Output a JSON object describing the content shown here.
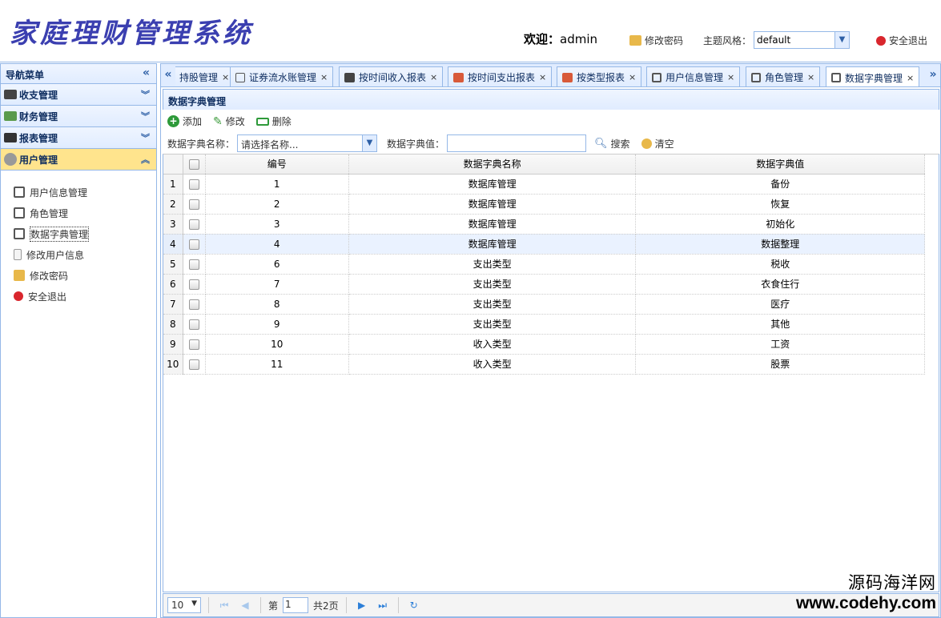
{
  "header": {
    "app_title": "家庭理财管理系统",
    "welcome_label": "欢迎：",
    "username": "admin",
    "change_password": "修改密码",
    "theme_label": "主题风格：",
    "theme_value": "default",
    "logout": "安全退出"
  },
  "sidebar": {
    "title": "导航菜单",
    "sections": [
      {
        "label": "收支管理"
      },
      {
        "label": "财务管理"
      },
      {
        "label": "报表管理"
      },
      {
        "label": "用户管理"
      }
    ],
    "items": [
      {
        "label": "用户信息管理"
      },
      {
        "label": "角色管理"
      },
      {
        "label": "数据字典管理"
      },
      {
        "label": "修改用户信息"
      },
      {
        "label": "修改密码"
      },
      {
        "label": "安全退出"
      }
    ]
  },
  "tabs": [
    {
      "label": "持股管理"
    },
    {
      "label": "证券流水账管理"
    },
    {
      "label": "按时间收入报表"
    },
    {
      "label": "按时间支出报表"
    },
    {
      "label": "按类型报表"
    },
    {
      "label": "用户信息管理"
    },
    {
      "label": "角色管理"
    },
    {
      "label": "数据字典管理"
    }
  ],
  "panel": {
    "title": "数据字典管理",
    "toolbar": {
      "add": "添加",
      "edit": "修改",
      "delete": "删除"
    },
    "search": {
      "name_label": "数据字典名称：",
      "name_value": "请选择名称...",
      "value_label": "数据字典值：",
      "search_btn": "搜索",
      "clear_btn": "清空"
    },
    "columns": [
      "编号",
      "数据字典名称",
      "数据字典值"
    ],
    "rows": [
      {
        "n": "1",
        "id": "1",
        "name": "数据库管理",
        "value": "备份"
      },
      {
        "n": "2",
        "id": "2",
        "name": "数据库管理",
        "value": "恢复"
      },
      {
        "n": "3",
        "id": "3",
        "name": "数据库管理",
        "value": "初始化"
      },
      {
        "n": "4",
        "id": "4",
        "name": "数据库管理",
        "value": "数据整理"
      },
      {
        "n": "5",
        "id": "6",
        "name": "支出类型",
        "value": "税收"
      },
      {
        "n": "6",
        "id": "7",
        "name": "支出类型",
        "value": "衣食住行"
      },
      {
        "n": "7",
        "id": "8",
        "name": "支出类型",
        "value": "医疗"
      },
      {
        "n": "8",
        "id": "9",
        "name": "支出类型",
        "value": "其他"
      },
      {
        "n": "9",
        "id": "10",
        "name": "收入类型",
        "value": "工资"
      },
      {
        "n": "10",
        "id": "11",
        "name": "收入类型",
        "value": "股票"
      }
    ]
  },
  "pager": {
    "page_size": "10",
    "page_prefix": "第",
    "page_value": "1",
    "page_total": "共2页"
  },
  "watermark": {
    "line1": "源码海洋网",
    "line2": "www.codehy.com"
  }
}
